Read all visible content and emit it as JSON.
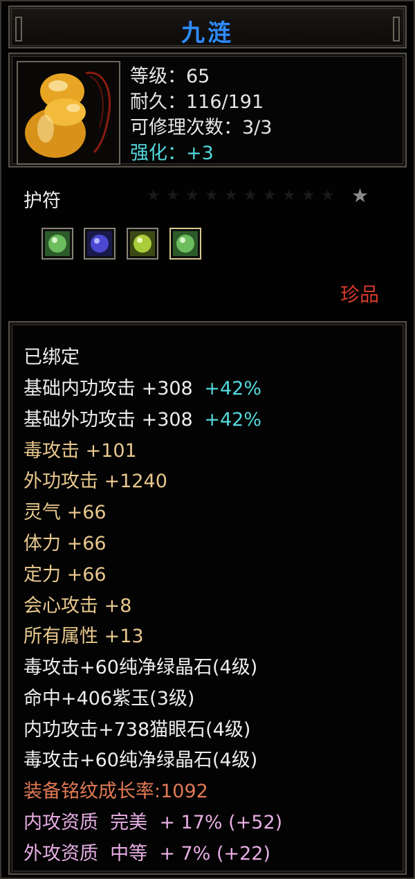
{
  "title": "九涟",
  "info": {
    "level_label": "等级：65",
    "durability_label": "耐久：116/191",
    "repair_label": "可修理次数：3/3",
    "enhance_label": "强化：",
    "enhance_value": "+3"
  },
  "item_type": "护符",
  "rarity": "珍品",
  "gems": [
    {
      "icon": "green-gem-icon",
      "color": "#5fa85a"
    },
    {
      "icon": "purple-gem-icon",
      "color": "#4a4ad6"
    },
    {
      "icon": "yellow-green-gem-icon",
      "color": "#a6c83a"
    },
    {
      "icon": "green-gem-icon",
      "color": "#5fa85a"
    }
  ],
  "bound": "已绑定",
  "base_attack": [
    {
      "label": "基础内功攻击 +308",
      "bonus": "+42%"
    },
    {
      "label": "基础外功攻击 +308",
      "bonus": "+42%"
    }
  ],
  "attributes": [
    "毒攻击 +101",
    "外功攻击 +1240",
    "灵气 +66",
    "体力 +66",
    "定力 +66",
    "会心攻击 +8",
    "所有属性 +13"
  ],
  "gem_effects": [
    "毒攻击+60纯净绿晶石(4级)",
    "命中+406紫玉(3级)",
    "内功攻击+738猫眼石(4级)",
    "毒攻击+60纯净绿晶石(4级)"
  ],
  "growth": "装备铭纹成长率:1092",
  "qualities": [
    "内攻资质  完美  + 17% (+52)",
    "外攻资质  中等  + 7% (+22)"
  ]
}
